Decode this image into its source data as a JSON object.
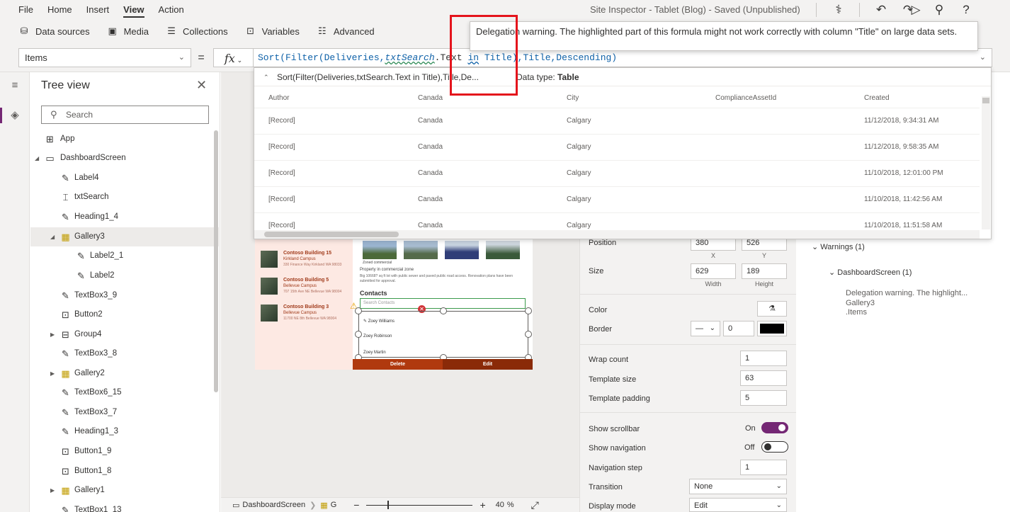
{
  "menubar": {
    "items": [
      "File",
      "Home",
      "Insert",
      "View",
      "Action"
    ],
    "active": "View",
    "title": "Site Inspector - Tablet (Blog) - Saved (Unpublished)"
  },
  "toolbar": {
    "items": [
      {
        "label": "Data sources",
        "icon": "database-icon"
      },
      {
        "label": "Media",
        "icon": "media-icon"
      },
      {
        "label": "Collections",
        "icon": "collections-icon"
      },
      {
        "label": "Variables",
        "icon": "variables-icon"
      },
      {
        "label": "Advanced",
        "icon": "advanced-icon"
      }
    ]
  },
  "formulabar": {
    "property": "Items",
    "equals": "=",
    "fx": "fx",
    "formula": {
      "p1": "Sort(Filter(Deliveries,",
      "p2": "txtSearch",
      "p3": ".Text ",
      "p4": "in",
      "p5": " Title),Title,Descending)"
    }
  },
  "tooltip": {
    "text": "Delegation warning. The highlighted part of this formula might not work correctly with column \"Title\" on large data sets."
  },
  "result": {
    "expression": "Sort(Filter(Deliveries,txtSearch.Text in Title),Title,De...",
    "dtype_label": "Data type:",
    "dtype_value": "Table",
    "columns": [
      "Author",
      "Canada",
      "City",
      "ComplianceAssetId",
      "Created"
    ],
    "rows": [
      [
        "[Record]",
        "Canada",
        "Calgary",
        "",
        "11/12/2018, 9:34:31 AM"
      ],
      [
        "[Record]",
        "Canada",
        "Calgary",
        "",
        "11/12/2018, 9:58:35 AM"
      ],
      [
        "[Record]",
        "Canada",
        "Calgary",
        "",
        "11/10/2018, 12:01:00 PM"
      ],
      [
        "[Record]",
        "Canada",
        "Calgary",
        "",
        "11/10/2018, 11:42:56 AM"
      ],
      [
        "[Record]",
        "Canada",
        "Calgary",
        "",
        "11/10/2018, 11:51:58 AM"
      ]
    ]
  },
  "treeview": {
    "title": "Tree view",
    "search_placeholder": "Search",
    "nodes": [
      {
        "label": "App",
        "icon": "app-icon"
      },
      {
        "label": "DashboardScreen",
        "icon": "screen-icon"
      },
      {
        "label": "Label4",
        "icon": "label-icon"
      },
      {
        "label": "txtSearch",
        "icon": "textinput-icon"
      },
      {
        "label": "Heading1_4",
        "icon": "label-icon"
      },
      {
        "label": "Gallery3",
        "icon": "gallery-icon"
      },
      {
        "label": "Label2_1",
        "icon": "label-icon"
      },
      {
        "label": "Label2",
        "icon": "label-icon"
      },
      {
        "label": "TextBox3_9",
        "icon": "label-icon"
      },
      {
        "label": "Button2",
        "icon": "button-icon"
      },
      {
        "label": "Group4",
        "icon": "group-icon"
      },
      {
        "label": "TextBox3_8",
        "icon": "label-icon"
      },
      {
        "label": "Gallery2",
        "icon": "gallery-icon"
      },
      {
        "label": "TextBox6_15",
        "icon": "label-icon"
      },
      {
        "label": "TextBox3_7",
        "icon": "label-icon"
      },
      {
        "label": "Heading1_3",
        "icon": "label-icon"
      },
      {
        "label": "Button1_9",
        "icon": "button-icon"
      },
      {
        "label": "Button1_8",
        "icon": "button-icon"
      },
      {
        "label": "Gallery1",
        "icon": "gallery-icon"
      },
      {
        "label": "TextBox1_13",
        "icon": "label-icon"
      }
    ]
  },
  "preview": {
    "buildings": [
      {
        "name": "Contoso Building 15",
        "campus": "Kirkland Campus",
        "addr": "330 Finance Way Kirkland WA 98033"
      },
      {
        "name": "Contoso Building 5",
        "campus": "Bellevue Campus",
        "addr": "707 15th Ave NE Bellevue WA 98004"
      },
      {
        "name": "Contoso Building 3",
        "campus": "Bellevue Campus",
        "addr": "11700 NE 8th Bellevue WA 98004"
      }
    ],
    "zoned": "Zoned commercial",
    "property": "Property in commercial zone",
    "desc": "Big 10668? sq ft lot with public sewer and paved public road access. Renovation plans have been submitted for approval.",
    "contacts_title": "Contacts",
    "search_placeholder": "Search Contacts",
    "contacts": [
      "Zoey Williams",
      "Zoey Robinson",
      "Zoey Martin"
    ],
    "delete_label": "Delete",
    "edit_label": "Edit"
  },
  "statusbar": {
    "screen": "DashboardScreen",
    "gallery": "G",
    "zoom": "40",
    "zoom_unit": "%"
  },
  "properties": {
    "position_label": "Position",
    "position_x": "380",
    "position_y": "526",
    "x_cap": "X",
    "y_cap": "Y",
    "size_label": "Size",
    "width": "629",
    "height": "189",
    "width_cap": "Width",
    "height_cap": "Height",
    "color_label": "Color",
    "border_label": "Border",
    "border_width": "0",
    "border_color": "#000000",
    "wrap_label": "Wrap count",
    "wrap_value": "1",
    "template_size_label": "Template size",
    "template_size_value": "63",
    "template_padding_label": "Template padding",
    "template_padding_value": "5",
    "show_scrollbar_label": "Show scrollbar",
    "show_scrollbar_state": "On",
    "show_navigation_label": "Show navigation",
    "show_navigation_state": "Off",
    "nav_step_label": "Navigation step",
    "nav_step_value": "1",
    "transition_label": "Transition",
    "transition_value": "None",
    "display_mode_label": "Display mode",
    "display_mode_value": "Edit"
  },
  "warnings": {
    "header": "Warnings (1)",
    "screen": "DashboardScreen (1)",
    "message": "Delegation warning. The highlight...",
    "control": "Gallery3",
    "property": ".Items"
  },
  "colors": {
    "accent": "#742774",
    "highlight": "#e4141c",
    "preview_button": "#b0390e"
  }
}
